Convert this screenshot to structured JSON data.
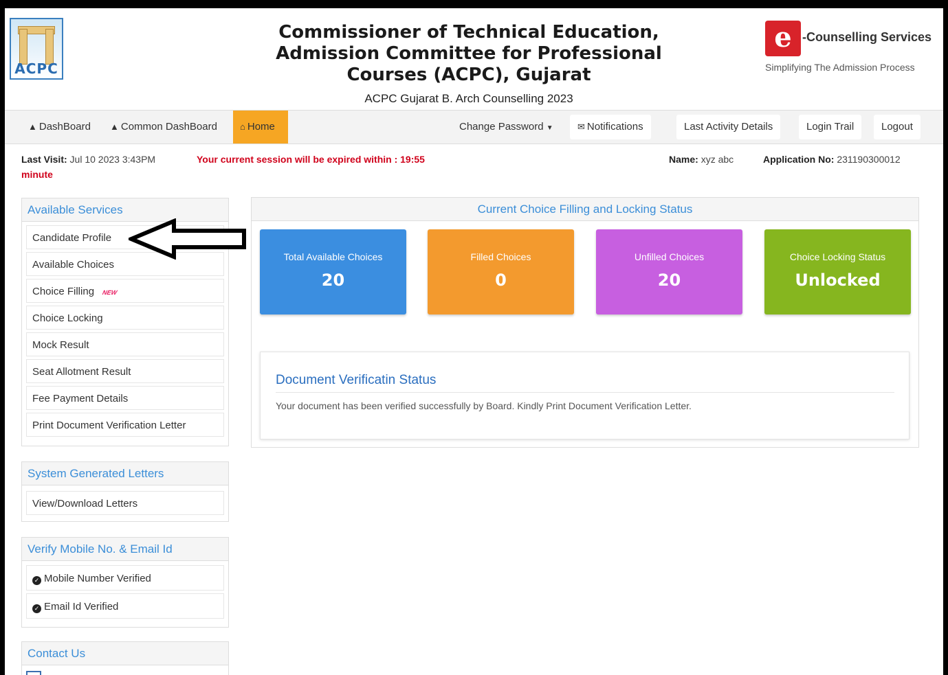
{
  "header": {
    "logo_text": "ACPC",
    "title_lines": [
      "Commissioner of Technical Education,",
      "Admission Committee for Professional",
      "Courses (ACPC), Gujarat"
    ],
    "subtitle": "ACPC Gujarat B. Arch Counselling 2023",
    "brand_name": "-Counselling Services",
    "brand_tagline": "Simplifying The Admission Process"
  },
  "navbar": {
    "dashboard": "DashBoard",
    "common_dashboard": "Common DashBoard",
    "home": "Home",
    "change_password": "Change Password",
    "notifications": "Notifications",
    "last_activity": "Last Activity Details",
    "login_trail": "Login Trail",
    "logout": "Logout"
  },
  "info": {
    "last_visit_label": "Last Visit:",
    "last_visit_value": "Jul 10 2023 3:43PM",
    "session_text": "Your current session will be expired within : 19:55",
    "session_unit": "minute",
    "name_label": "Name:",
    "name_value": "xyz abc",
    "app_label": "Application No:",
    "app_value": "231190300012"
  },
  "sidebar": {
    "services": {
      "title": "Available Services",
      "items": [
        "Candidate Profile",
        "Available Choices",
        "Choice Filling",
        "Choice Locking",
        "Mock Result",
        "Seat Allotment Result",
        "Fee Payment Details",
        "Print Document Verification Letter"
      ],
      "new_badge": "NEW"
    },
    "letters": {
      "title": "System Generated Letters",
      "items": [
        "View/Download Letters"
      ]
    },
    "verify": {
      "title": "Verify Mobile No. & Email Id",
      "items": [
        "Mobile Number Verified",
        "Email Id Verified"
      ]
    },
    "contact": {
      "title": "Contact Us"
    }
  },
  "status": {
    "title": "Current Choice Filling and Locking Status",
    "tiles": [
      {
        "label": "Total Available Choices",
        "value": "20",
        "color": "#3b8ee0"
      },
      {
        "label": "Filled Choices",
        "value": "0",
        "color": "#f39a2e"
      },
      {
        "label": "Unfilled Choices",
        "value": "20",
        "color": "#c75fe0"
      },
      {
        "label": "Choice Locking Status",
        "value": "Unlocked",
        "color": "#86b61f"
      }
    ]
  },
  "document": {
    "title": "Document Verificatin Status",
    "text": "Your document has been verified successfully by Board. Kindly Print Document Verification Letter."
  }
}
